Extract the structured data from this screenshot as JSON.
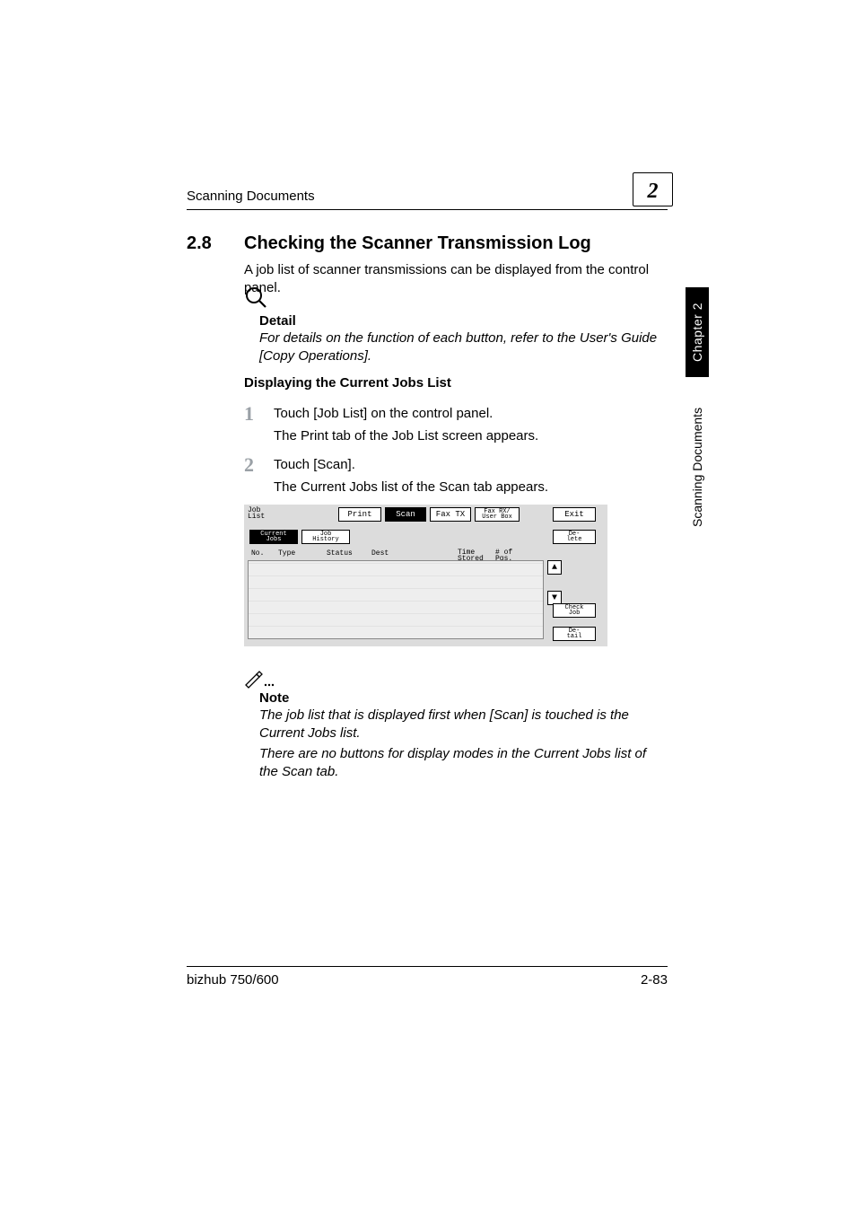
{
  "header": {
    "running": "Scanning Documents",
    "chapter_num": "2"
  },
  "section": {
    "num": "2.8",
    "title": "Checking the Scanner Transmission Log",
    "intro": "A job list of scanner transmissions can be displayed from the control panel."
  },
  "detail": {
    "label": "Detail",
    "text": "For details on the function of each button, refer to the User's Guide [Copy Operations]."
  },
  "subhead": "Displaying the Current Jobs List",
  "steps": {
    "s1": {
      "num": "1",
      "a": "Touch [Job List] on the control panel.",
      "b": "The Print tab of the Job List screen appears."
    },
    "s2": {
      "num": "2",
      "a": "Touch [Scan].",
      "b": "The Current Jobs list of the Scan tab appears."
    }
  },
  "panel": {
    "job_list": "Job\nList",
    "tabs": {
      "print": "Print",
      "scan": "Scan",
      "faxtx": "Fax TX",
      "faxrx": "Fax RX/\nUser Box",
      "exit": "Exit"
    },
    "subtabs": {
      "current": "Current\nJobs",
      "history": "Job\nHistory"
    },
    "buttons": {
      "delete": "De-\nlete",
      "check": "Check\nJob",
      "detail": "De-\ntail"
    },
    "columns": {
      "no": "No.",
      "type": "Type",
      "status": "Status",
      "dest": "Dest",
      "stored": "Time\nStored",
      "pgs": "# of\nPgs."
    },
    "scroll": {
      "up": "▲",
      "down": "▼"
    }
  },
  "note": {
    "label": "Note",
    "p1": "The job list that is displayed first when [Scan] is touched is the Current Jobs list.",
    "p2": "There are no buttons for display modes in the Current Jobs list of the Scan tab."
  },
  "footer": {
    "left": "bizhub 750/600",
    "right": "2-83"
  },
  "side": {
    "chapter": "Chapter 2",
    "title": "Scanning Documents"
  }
}
